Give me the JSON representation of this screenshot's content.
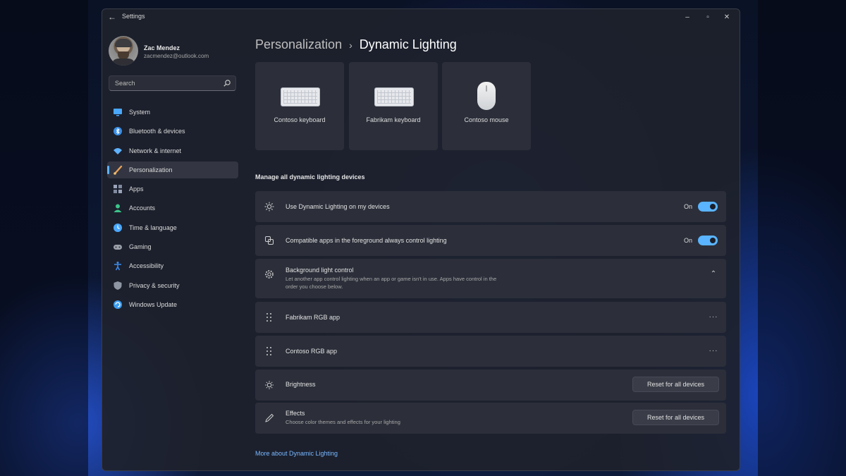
{
  "window": {
    "title": "Settings",
    "back_icon": "arrow-left-icon",
    "controls": {
      "minimize": "–",
      "maximize": "▫",
      "close": "✕"
    }
  },
  "user": {
    "name": "Zac Mendez",
    "email": "zacmendez@outlook.com"
  },
  "search": {
    "placeholder": "Search"
  },
  "sidebar": {
    "items": [
      {
        "label": "System",
        "icon": "monitor-icon",
        "color": "#4aa8ff"
      },
      {
        "label": "Bluetooth & devices",
        "icon": "bluetooth-icon",
        "color": "#3a8fe8"
      },
      {
        "label": "Network & internet",
        "icon": "wifi-icon",
        "color": "#5fb2ff"
      },
      {
        "label": "Personalization",
        "icon": "brush-icon",
        "color": "#e8a25a"
      },
      {
        "label": "Apps",
        "icon": "apps-icon",
        "color": "#9aa4b8"
      },
      {
        "label": "Accounts",
        "icon": "person-icon",
        "color": "#3cc48a"
      },
      {
        "label": "Time & language",
        "icon": "globe-clock-icon",
        "color": "#4aa8ff"
      },
      {
        "label": "Gaming",
        "icon": "gamepad-icon",
        "color": "#9aa0aa"
      },
      {
        "label": "Accessibility",
        "icon": "accessibility-icon",
        "color": "#3d8ef0"
      },
      {
        "label": "Privacy & security",
        "icon": "shield-icon",
        "color": "#8f96a3"
      },
      {
        "label": "Windows Update",
        "icon": "update-icon",
        "color": "#3d9cf0"
      }
    ],
    "active_index": 3
  },
  "breadcrumb": {
    "parent": "Personalization",
    "separator": "›",
    "current": "Dynamic Lighting"
  },
  "devices": [
    {
      "label": "Contoso keyboard",
      "icon": "keyboard-icon"
    },
    {
      "label": "Fabrikam keyboard",
      "icon": "keyboard-icon"
    },
    {
      "label": "Contoso mouse",
      "icon": "mouse-icon"
    }
  ],
  "section_title": "Manage all dynamic lighting devices",
  "settings": {
    "use_dynamic": {
      "label": "Use Dynamic Lighting on my devices",
      "state": "On",
      "icon": "sun-rays-icon"
    },
    "compatible_apps": {
      "label": "Compatible apps in the foreground always control lighting",
      "state": "On",
      "icon": "apps-lighting-icon"
    },
    "background_control": {
      "label": "Background light control",
      "description": "Let another app control lighting when an app or game isn't in use. Apps have control in the order you choose below.",
      "icon": "gear-icon",
      "expanded_glyph": "⌃"
    },
    "apps": [
      {
        "label": "Fabrikam RGB app",
        "more": "···"
      },
      {
        "label": "Contoso RGB app",
        "more": "···"
      }
    ],
    "brightness": {
      "label": "Brightness",
      "button": "Reset for all devices",
      "icon": "brightness-icon"
    },
    "effects": {
      "label": "Effects",
      "description": "Choose color themes and effects for your lighting",
      "button": "Reset for all devices",
      "icon": "pen-icon"
    }
  },
  "footer_link": "More about Dynamic Lighting",
  "colors": {
    "accent": "#5ab4ff",
    "link": "#79b8ff",
    "card_bg": "#2c2f3a",
    "window_bg": "#1e212c"
  }
}
